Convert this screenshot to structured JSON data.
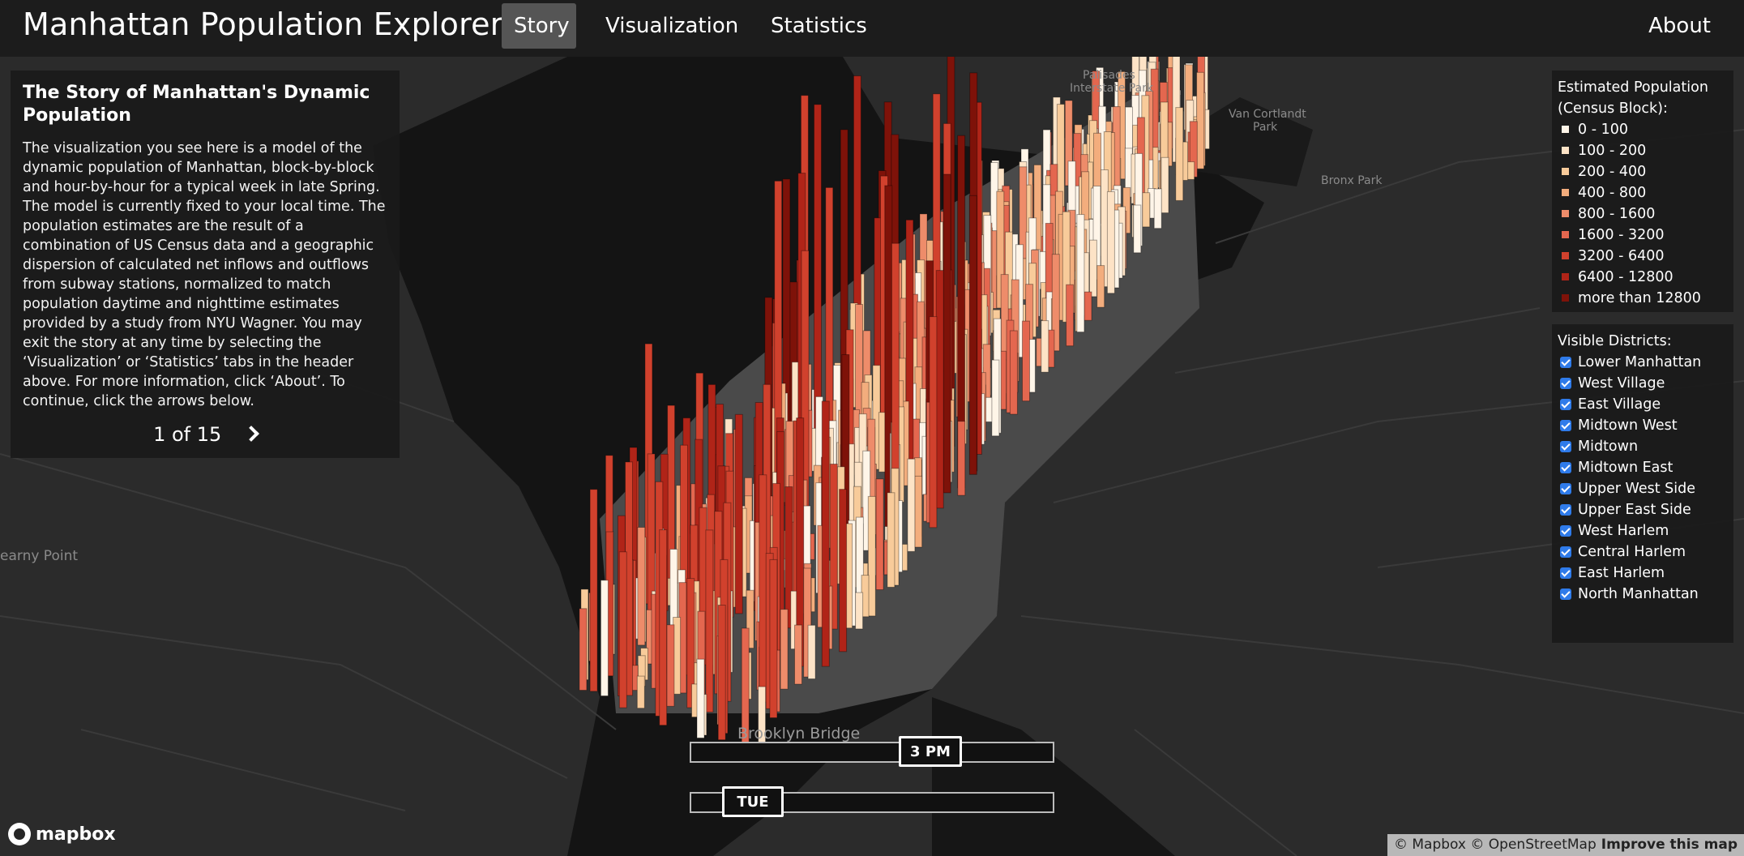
{
  "header": {
    "title": "Manhattan Population Explorer",
    "tabs": [
      {
        "label": "Story",
        "active": true
      },
      {
        "label": "Visualization",
        "active": false
      },
      {
        "label": "Statistics",
        "active": false
      }
    ],
    "about_label": "About"
  },
  "story": {
    "heading": "The Story of Manhattan's Dynamic Population",
    "body": "The visualization you see here is a model of the dynamic population of Manhattan, block-by-block and hour-by-hour for a typical week in late Spring. The model is currently fixed to your local time. The population estimates are the result of a combination of US Census data and a geographic dispersion of calculated net inflows and outflows from subway stations, normalized to match population daytime and nighttime estimates provided by a study from NYU Wagner. You may exit the story at any time by selecting the ‘Visualization’ or ‘Statistics’ tabs in the header above. For more information, click ‘About’. To continue, click the arrows below.",
    "pager": "1 of 15",
    "next_icon": "chevron-right-icon"
  },
  "legend": {
    "title_line1": "Estimated Population",
    "title_line2": "(Census Block):",
    "items": [
      {
        "label": "0 - 100",
        "color": "#fff5e8"
      },
      {
        "label": "100 - 200",
        "color": "#fde3c6"
      },
      {
        "label": "200 - 400",
        "color": "#f8cb9a"
      },
      {
        "label": "400 - 800",
        "color": "#f3ad7d"
      },
      {
        "label": "800 - 1600",
        "color": "#ee8c6a"
      },
      {
        "label": "1600 - 3200",
        "color": "#e4674f"
      },
      {
        "label": "3200 - 6400",
        "color": "#d1412d"
      },
      {
        "label": "6400 - 12800",
        "color": "#b02418"
      },
      {
        "label": "more than 12800",
        "color": "#7e1209"
      }
    ]
  },
  "districts": {
    "title": "Visible Districts:",
    "items": [
      {
        "label": "Lower Manhattan",
        "checked": true
      },
      {
        "label": "West Village",
        "checked": true
      },
      {
        "label": "East Village",
        "checked": true
      },
      {
        "label": "Midtown West",
        "checked": true
      },
      {
        "label": "Midtown",
        "checked": true
      },
      {
        "label": "Midtown East",
        "checked": true
      },
      {
        "label": "Upper West Side",
        "checked": true
      },
      {
        "label": "Upper East Side",
        "checked": true
      },
      {
        "label": "West Harlem",
        "checked": true
      },
      {
        "label": "Central Harlem",
        "checked": true
      },
      {
        "label": "East Harlem",
        "checked": true
      },
      {
        "label": "North Manhattan",
        "checked": true
      }
    ]
  },
  "controls": {
    "time_label": "3 PM",
    "day_label": "TUE"
  },
  "map": {
    "places": [
      {
        "label": "Palisades\nInterstate Park"
      },
      {
        "label": "Van Cortlandt\nPark"
      },
      {
        "label": "Bronx Park"
      },
      {
        "label": "earny Point"
      },
      {
        "label": "Brooklyn Bridge"
      }
    ]
  },
  "attribution": {
    "logo_text": "mapbox",
    "text": "© Mapbox © OpenStreetMap",
    "improve": "Improve this map"
  }
}
